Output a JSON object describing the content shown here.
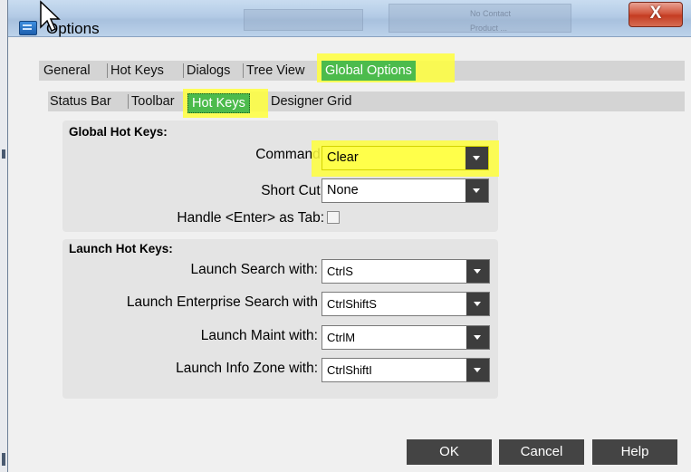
{
  "window": {
    "title": "Options",
    "close_label": "X"
  },
  "background_ghost_text": [
    "No Contact",
    "Product ..."
  ],
  "tabs_primary": [
    {
      "label": "General"
    },
    {
      "label": "Hot Keys"
    },
    {
      "label": "Dialogs"
    },
    {
      "label": "Tree View"
    },
    {
      "label": "Global Options",
      "active": true
    }
  ],
  "tabs_secondary": [
    {
      "label": "Status Bar"
    },
    {
      "label": "Toolbar"
    },
    {
      "label": "Hot Keys",
      "active": true
    },
    {
      "label": "Designer Grid"
    }
  ],
  "global_hot_keys": {
    "title": "Global Hot Keys:",
    "command": {
      "label": "Command:",
      "value": "Clear"
    },
    "short_cut": {
      "label": "Short Cut:",
      "value": "None"
    },
    "handle_enter": {
      "label": "Handle <Enter> as Tab:",
      "checked": false
    }
  },
  "launch_hot_keys": {
    "title": "Launch Hot Keys:",
    "rows": [
      {
        "label": "Launch Search with:",
        "value": "CtrlS"
      },
      {
        "label": "Launch Enterprise Search with",
        "value": "CtrlShiftS"
      },
      {
        "label": "Launch Maint with:",
        "value": "CtrlM"
      },
      {
        "label": "Launch Info Zone with:",
        "value": "CtrlShiftI"
      }
    ]
  },
  "buttons": {
    "ok": "OK",
    "cancel": "Cancel",
    "help": "Help"
  },
  "colors": {
    "active_tab": "#4cbb4c",
    "highlight": "#ffff3c",
    "button_bg": "#444444",
    "close_button": "#c43c22"
  }
}
